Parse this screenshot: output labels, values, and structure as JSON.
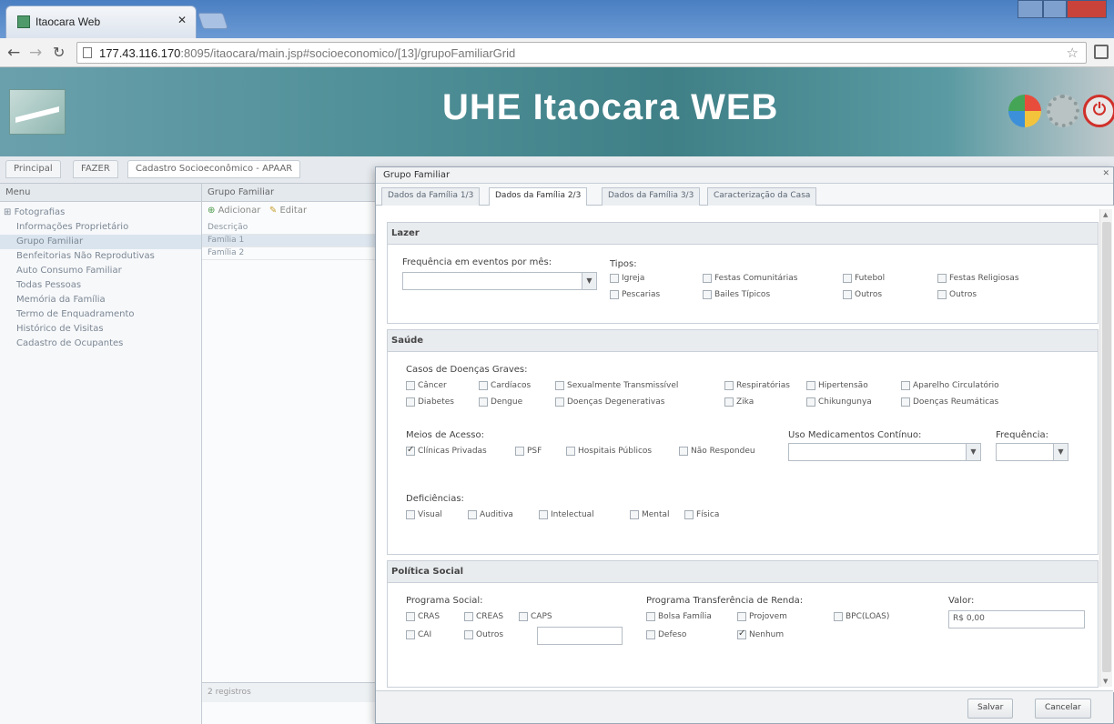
{
  "browser": {
    "tab_title": "Itaocara Web",
    "url_host": "177.43.116.170",
    "url_path": ":8095/itaocara/main.jsp#socioeconomico/[13]/grupoFamiliarGrid"
  },
  "header": {
    "title": "UHE Itaocara WEB"
  },
  "breadcrumbs": [
    "Principal",
    "FAZER",
    "Cadastro Socioeconômico - APAAR"
  ],
  "menu": {
    "title": "Menu",
    "root": "Fotografias",
    "items": [
      "Informações Proprietário",
      "Grupo Familiar",
      "Benfeitorias Não Reprodutivas",
      "Auto Consumo Familiar",
      "Todas Pessoas",
      "Memória da Família",
      "Termo de Enquadramento",
      "Histórico de Visitas",
      "Cadastro de Ocupantes"
    ]
  },
  "grid": {
    "title": "Grupo Familiar",
    "toolbar": [
      "Adicionar",
      "Editar"
    ],
    "rows": [
      "Descrição",
      "Família 1",
      "Família 2"
    ],
    "footer": "2 registros"
  },
  "modal": {
    "title": "Grupo Familiar",
    "tabs": [
      "Dados da Família 1/3",
      "Dados da Família 2/3",
      "Dados da Família 3/3",
      "Caracterização da Casa"
    ],
    "lazer": {
      "title": "Lazer",
      "freq_label": "Frequência em eventos por mês:",
      "tipos_label": "Tipos:",
      "options": [
        "Igreja",
        "Festas Comunitárias",
        "Futebol",
        "Festas Religiosas",
        "Pescarias",
        "Bailes Típicos",
        "Outros",
        "Outros"
      ]
    },
    "saude": {
      "title": "Saúde",
      "diseases_label": "Casos de Doenças Graves:",
      "diseases": [
        "Câncer",
        "Cardíacos",
        "Sexualmente Transmissível",
        "Respiratórias",
        "Hipertensão",
        "Aparelho Circulatório",
        "Diabetes",
        "Dengue",
        "Doenças Degenerativas",
        "Zika",
        "Chikungunya",
        "Doenças Reumáticas"
      ],
      "access_label": "Meios de Acesso:",
      "access": [
        "Clínicas Privadas",
        "PSF",
        "Hospitais Públicos",
        "Não Respondeu"
      ],
      "meds_label": "Uso Medicamentos Contínuo:",
      "freq_label": "Frequência:",
      "deficiency_label": "Deficiências:",
      "deficiencies": [
        "Visual",
        "Auditiva",
        "Intelectual",
        "Mental",
        "Física"
      ]
    },
    "politica": {
      "title": "Política Social",
      "programs_label": "Programa Social:",
      "programs": [
        "CRAS",
        "CREAS",
        "CAPS",
        "CAI",
        "Outros"
      ],
      "income_label": "Programa Transferência de Renda:",
      "income": [
        "Bolsa Família",
        "Projovem",
        "BPC(LOAS)",
        "Defeso",
        "Nenhum"
      ],
      "value_label": "Valor:",
      "value": "R$ 0,00"
    },
    "buttons": {
      "save": "Salvar",
      "cancel": "Cancelar"
    }
  }
}
